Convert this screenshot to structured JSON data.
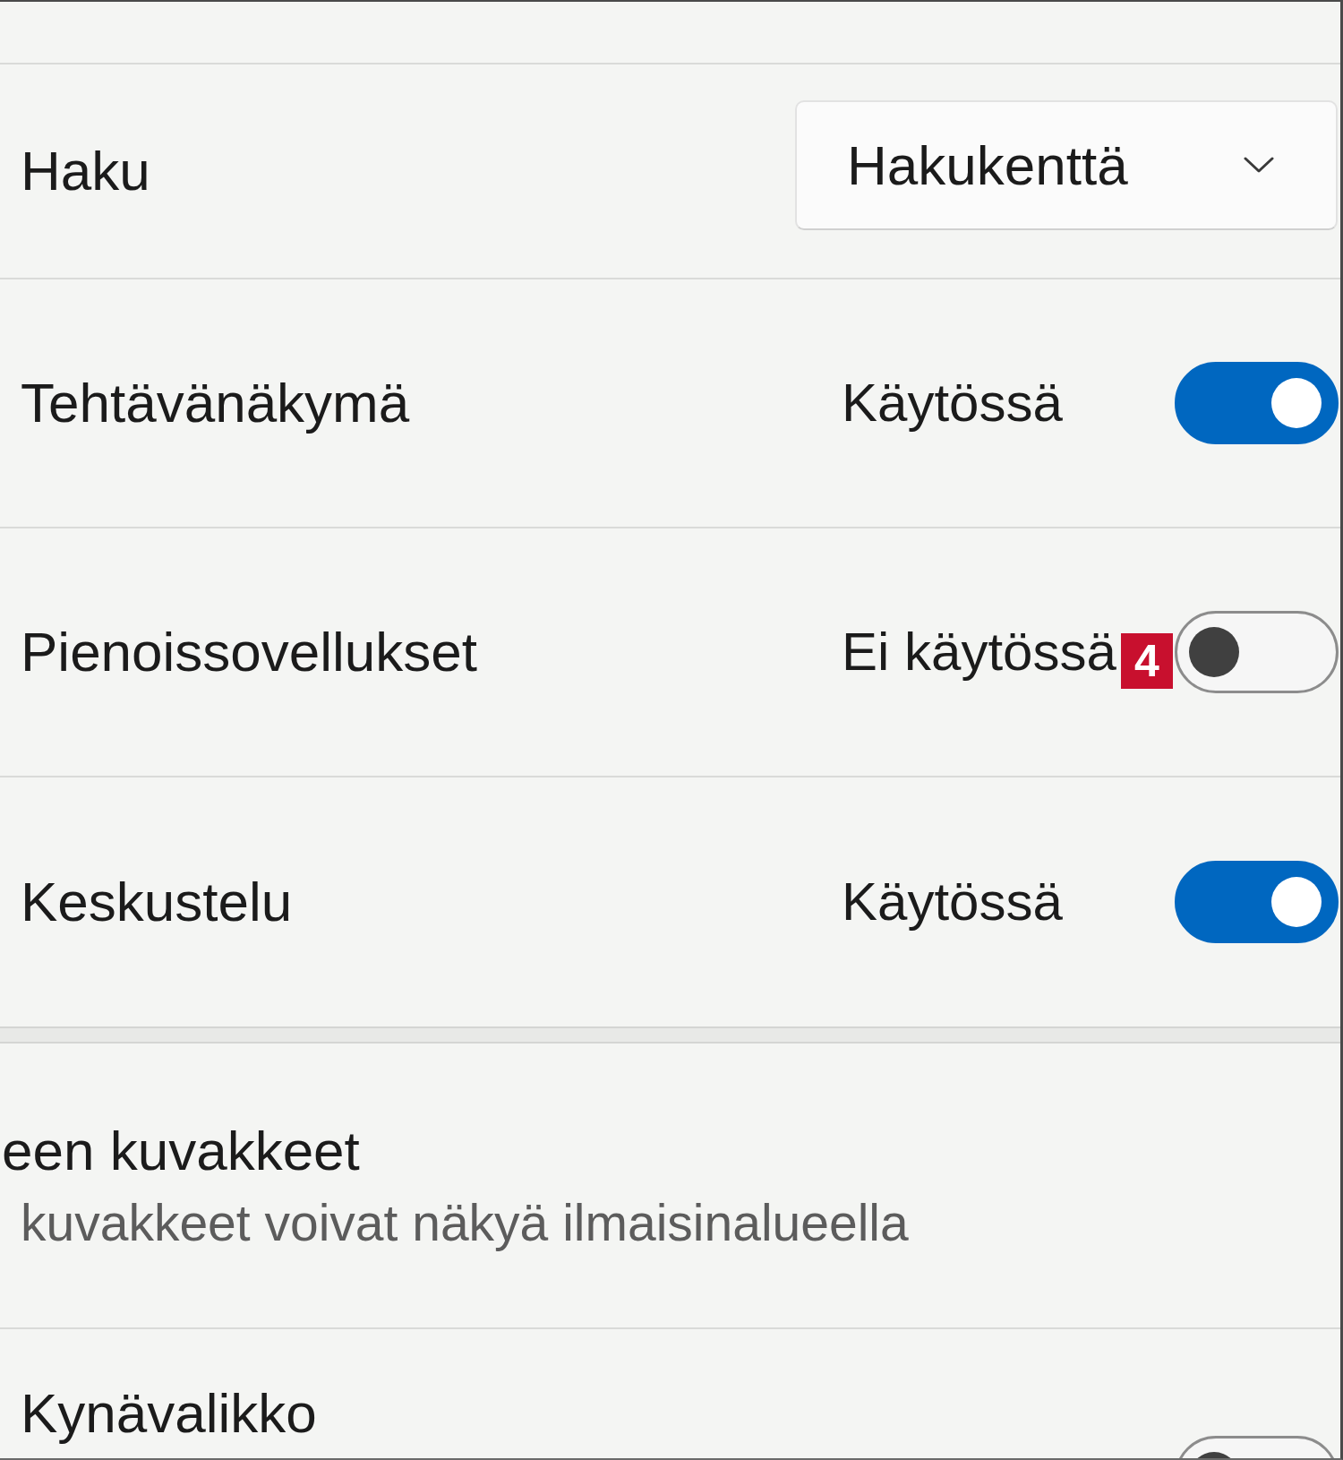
{
  "groups": [
    {
      "rows": [
        {
          "kind": "dropdown",
          "label": "Haku",
          "value": "Hakukenttä"
        },
        {
          "kind": "toggle",
          "label": "Tehtävänäkymä",
          "status": "Käytössä",
          "on": true
        },
        {
          "kind": "toggle",
          "label": "Pienoissovellukset",
          "status": "Ei käytössä",
          "on": false,
          "marker": "4"
        },
        {
          "kind": "toggle",
          "label": "Keskustelu",
          "status": "Käytössä",
          "on": true
        }
      ]
    },
    {
      "rows": [
        {
          "kind": "info",
          "label": "een kuvakkeet",
          "description": "kuvakkeet voivat näkyä ilmaisinalueella"
        },
        {
          "kind": "toggle",
          "label": "Kynävalikko",
          "on": false
        }
      ]
    }
  ]
}
